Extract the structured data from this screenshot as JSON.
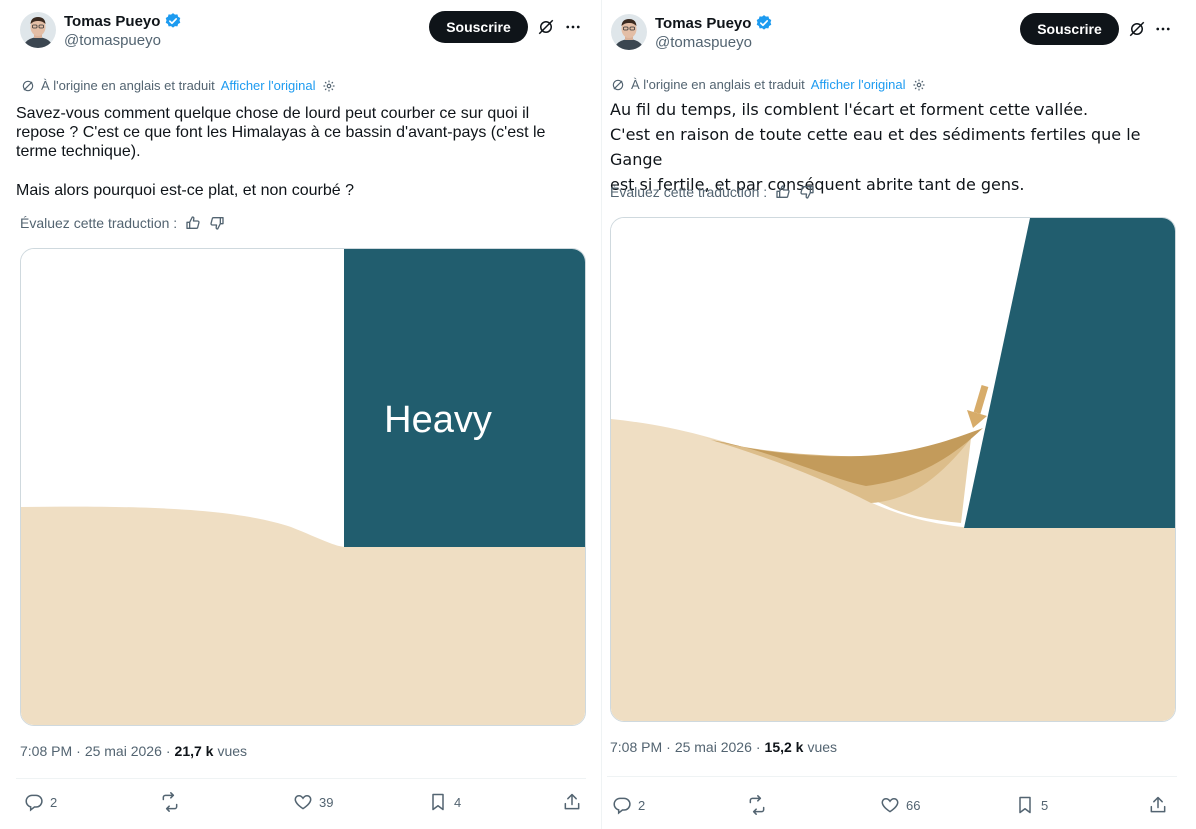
{
  "left": {
    "author": {
      "name": "Tomas Pueyo",
      "handle": "@tomaspueyo"
    },
    "subscribe_label": "Souscrire",
    "translation": {
      "label": "À l'origine en anglais et traduit",
      "link": "Afficher l'original"
    },
    "text_p1": "Savez-vous comment quelque chose de lourd peut courber ce sur quoi il\nrepose ? C'est ce que font les Himalayas à ce bassin d'avant-pays (c'est le\nterme technique).",
    "text_p2": "Mais alors pourquoi est-ce plat, et non courbé ?",
    "rate_label": "Évaluez cette traduction :",
    "image_label": "Heavy",
    "meta": {
      "time": "7:08 PM",
      "sep1": "·",
      "date": "25 mai 2026",
      "sep2": "·",
      "views_count": "21,7 k",
      "views_label": "vues"
    },
    "actions": {
      "replies": "2",
      "likes": "39",
      "bookmarks": "4"
    }
  },
  "right": {
    "author": {
      "name": "Tomas Pueyo",
      "handle": "@tomaspueyo"
    },
    "subscribe_label": "Souscrire",
    "translation": {
      "label": "À l'origine en anglais et traduit",
      "link": "Afficher l'original"
    },
    "text": "Au fil du temps, ils comblent l'écart et forment cette vallée.\nC'est en raison de toute cette eau et des sédiments fertiles que le Gange\nest si fertile, et par conséquent abrite tant de gens.",
    "rate_label": "Évaluez cette traduction :",
    "meta": {
      "time": "7:08 PM",
      "sep1": "·",
      "date": "25 mai 2026",
      "sep2": "·",
      "views_count": "15,2 k",
      "views_label": "vues"
    },
    "actions": {
      "replies": "2",
      "likes": "66",
      "bookmarks": "5"
    }
  },
  "colors": {
    "teal": "#215d6e",
    "sand": "#efdec3",
    "sediment_dark": "#c39b5b",
    "sediment_mid": "#dcbd8a",
    "sediment_light": "#e8d2ad",
    "arrow": "#d7ac6a",
    "verified": "#1d9bf0",
    "button": "#0f1419"
  },
  "icons": [
    "verified-badge-icon",
    "translate-off-icon",
    "more-icon",
    "translate-icon",
    "settings-icon",
    "thumbs-up-icon",
    "thumbs-down-icon",
    "reply-icon",
    "retweet-icon",
    "like-icon",
    "bookmark-icon",
    "share-icon"
  ]
}
